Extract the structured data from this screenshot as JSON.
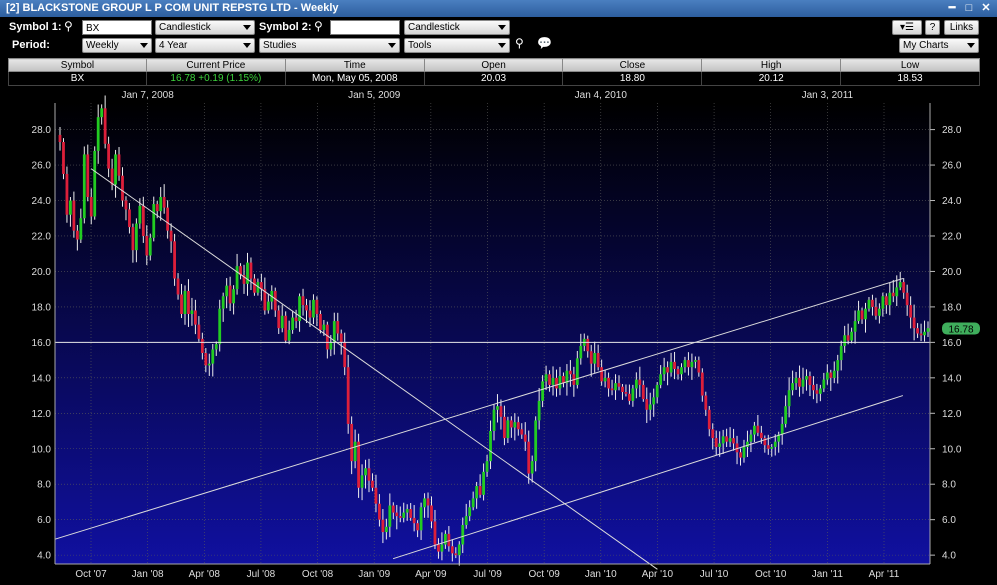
{
  "window": {
    "title": "[2] BLACKSTONE GROUP L P   COM UNIT REPSTG LTD - Weekly"
  },
  "toolbar": {
    "symbol1_label": "Symbol 1:",
    "symbol1_value": "BX",
    "chart_type1": "Candlestick",
    "symbol2_label": "Symbol 2:",
    "symbol2_value": "",
    "chart_type2": "Candlestick",
    "period_label": "Period:",
    "period_value": "Weekly",
    "range_value": "4 Year",
    "studies_label": "Studies",
    "tools_label": "Tools",
    "mycharts_label": "My Charts",
    "help_label": "?",
    "links_label": "Links"
  },
  "quote": {
    "headers": [
      "Symbol",
      "Current Price",
      "Time",
      "Open",
      "Close",
      "High",
      "Low"
    ],
    "symbol": "BX",
    "current_price": "16.78 +0.19 (1.15%)",
    "time": "Mon, May 05, 2008",
    "open": "20.03",
    "close": "18.80",
    "high": "20.12",
    "low": "18.53"
  },
  "colors": {
    "up": "#22cc22",
    "down": "#dd1f3a",
    "bg_top": "#000000",
    "bg_bottom": "#1010a0",
    "price_tag": "#3fae5c",
    "grid": "#5a5a5a"
  },
  "chart_data": {
    "type": "candlestick",
    "ylim": [
      3.5,
      29.5
    ],
    "y_ticks": [
      "4.0",
      "6.0",
      "8.0",
      "10.0",
      "12.0",
      "14.0",
      "16.0",
      "18.0",
      "20.0",
      "22.0",
      "24.0",
      "26.0",
      "28.0"
    ],
    "x_ticks_bottom": [
      "Oct '07",
      "Jan '08",
      "Apr '08",
      "Jul '08",
      "Oct '08",
      "Jan '09",
      "Apr '09",
      "Jul '09",
      "Oct '09",
      "Jan '10",
      "Apr '10",
      "Jul '10",
      "Oct '10",
      "Jan '11",
      "Apr '11"
    ],
    "x_ticks_top": [
      "Jan 7, 2008",
      "Jan 5, 2009",
      "Jan 4, 2010",
      "Jan 3, 2011"
    ],
    "current_price_label": "16.78",
    "horizontal_line": 16.0,
    "trendlines": [
      {
        "from": [
          "Oct '07",
          25.8
        ],
        "to": [
          "Apr '10",
          3.2
        ]
      },
      {
        "from": [
          "Jul '07",
          4.9
        ],
        "to": [
          "May '11",
          19.6
        ]
      },
      {
        "from": [
          "Feb '09",
          3.8
        ],
        "to": [
          "May '11",
          13.0
        ]
      }
    ],
    "weekly_close": [
      27.3,
      25.5,
      23.2,
      24.0,
      22.3,
      21.8,
      23.0,
      26.6,
      24.2,
      23.1,
      26.8,
      28.7,
      29.2,
      27.2,
      25.8,
      24.9,
      26.6,
      25.4,
      24.0,
      23.5,
      22.5,
      21.2,
      22.7,
      23.7,
      22.0,
      20.9,
      21.9,
      23.8,
      23.4,
      24.2,
      23.6,
      22.3,
      21.7,
      19.6,
      18.7,
      17.6,
      18.9,
      17.6,
      17.8,
      17.0,
      16.2,
      15.4,
      14.7,
      14.8,
      15.6,
      15.9,
      17.9,
      18.6,
      19.2,
      18.2,
      19.0,
      20.3,
      19.8,
      19.3,
      20.5,
      19.6,
      18.8,
      19.4,
      19.0,
      17.8,
      18.3,
      18.9,
      17.8,
      16.8,
      17.5,
      16.1,
      16.7,
      17.4,
      17.2,
      18.6,
      18.1,
      17.8,
      17.4,
      18.4,
      17.6,
      16.7,
      17.0,
      15.6,
      16.0,
      17.2,
      16.5,
      16.0,
      14.6,
      11.4,
      9.3,
      10.4,
      7.8,
      8.5,
      8.9,
      8.2,
      7.8,
      6.9,
      6.0,
      5.3,
      5.6,
      6.8,
      6.4,
      6.2,
      6.1,
      6.4,
      6.6,
      6.1,
      5.8,
      5.4,
      6.7,
      7.2,
      6.8,
      5.9,
      4.6,
      4.2,
      4.6,
      5.2,
      4.5,
      4.1,
      4.0,
      4.6,
      5.7,
      6.2,
      6.7,
      7.2,
      7.9,
      7.4,
      8.7,
      9.3,
      11.0,
      12.2,
      12.4,
      11.8,
      10.6,
      11.6,
      11.2,
      11.5,
      11.1,
      10.8,
      10.4,
      8.6,
      9.3,
      11.6,
      12.7,
      13.8,
      14.2,
      13.6,
      14.0,
      13.4,
      14.1,
      13.7,
      14.4,
      14.2,
      13.6,
      15.1,
      15.8,
      16.2,
      15.5,
      14.8,
      15.4,
      14.6,
      13.8,
      14.0,
      13.4,
      13.3,
      13.7,
      13.5,
      13.2,
      13.1,
      12.7,
      13.4,
      13.9,
      13.6,
      12.8,
      12.2,
      12.5,
      12.9,
      13.6,
      14.2,
      14.6,
      14.3,
      14.9,
      14.5,
      14.2,
      14.6,
      15.0,
      14.6,
      14.9,
      15.0,
      14.3,
      13.0,
      12.2,
      11.1,
      10.6,
      10.1,
      10.3,
      10.7,
      10.4,
      10.6,
      10.3,
      9.8,
      9.5,
      10.1,
      10.4,
      10.8,
      11.3,
      10.9,
      10.6,
      10.2,
      10.0,
      10.1,
      10.4,
      10.8,
      11.4,
      12.4,
      13.3,
      13.7,
      14.0,
      13.5,
      13.9,
      14.1,
      13.6,
      13.3,
      13.1,
      13.4,
      13.9,
      14.3,
      14.0,
      14.4,
      15.0,
      15.8,
      16.4,
      16.1,
      16.6,
      17.2,
      17.8,
      17.3,
      17.9,
      18.4,
      18.0,
      17.5,
      17.9,
      18.6,
      18.1,
      18.8,
      18.6,
      19.1,
      19.4,
      18.8,
      18.1,
      17.4,
      16.8,
      16.5,
      16.4,
      16.6,
      16.8
    ]
  }
}
